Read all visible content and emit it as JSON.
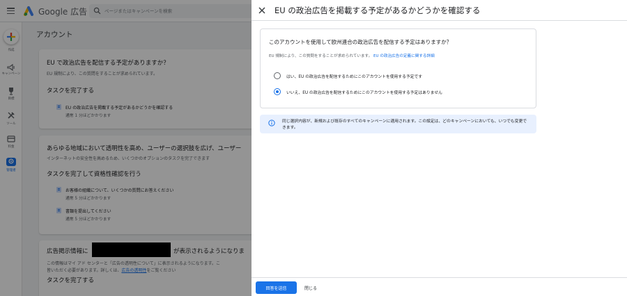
{
  "app": {
    "brand": "Google 広告",
    "search_placeholder": "ページまたはキャンペーンを検索"
  },
  "nav": {
    "create_label": "作成",
    "items": [
      {
        "label": "キャンペーン",
        "icon": "campaign-icon"
      },
      {
        "label": "目標",
        "icon": "trophy-icon"
      },
      {
        "label": "ツール",
        "icon": "tools-icon"
      },
      {
        "label": "料金",
        "icon": "billing-icon"
      },
      {
        "label": "管理者",
        "icon": "admin-icon"
      }
    ]
  },
  "page": {
    "title": "アカウント",
    "cards": [
      {
        "title": "EU で政治広告を配信する予定がありますか？",
        "subtitle": "EU 規制により、この質問をすることが求められています。",
        "section": "タスクを完了する",
        "tasks": [
          {
            "text": "EU の政治広告を掲載する予定があるかどうかを確認する",
            "note": "通常 1 分ほどかかります"
          }
        ]
      },
      {
        "title": "あらゆる地域において透明性を高め、ユーザーの選択肢を広げ、ユーザー",
        "subtitle": "インターネットの安全性を高めるため、いくつかのオプションのタスクを完了できます",
        "section": "タスクを完了して資格性確認を行う",
        "tasks": [
          {
            "text": "お客様の組織について、いくつかの質問にお答えください",
            "note": "通常 5 分ほどかかります"
          },
          {
            "text": "書類を提出してください",
            "note": "通常 5 分ほどかかります"
          }
        ]
      },
      {
        "title_prefix": "広告掲示情報に",
        "title_suffix": "が表示されるようになりま",
        "line1": "この情報はマイ アド センターと「広告の透明性について」に表示されるようになります。こ",
        "line2_prefix": "皆いただく必要があります。詳しくは、",
        "line2_link": "広告の透明性",
        "line2_suffix": "をご覧ください",
        "section": "タスクを完了する"
      }
    ]
  },
  "dialog": {
    "title": "EU の政治広告を掲載する予定があるかどうかを確認する",
    "question": "このアカウントを使用して欧州連合の政治広告を配信する予定はありますか？",
    "description": "EU 規制により、この質問をすることが求められています。",
    "description_link": "EU の政治広告の定義に関する詳細",
    "options": [
      {
        "label": "はい、EU の政治広告を配信するためにこのアカウントを使用する予定です",
        "checked": false
      },
      {
        "label": "いいえ、EU の政治広告を配信するためにこのアカウントを使用する予定はありません",
        "checked": true
      }
    ],
    "info": "同じ選択内容が、新規および既存のすべてのキャンペーンに適用されます。この設定は、どのキャンペーンにおいても、いつでも変更できます。",
    "submit_label": "回答を送信",
    "close_label": "閉じる"
  },
  "colors": {
    "accent": "#1a73e8",
    "info_bg": "#e8f0fe"
  }
}
